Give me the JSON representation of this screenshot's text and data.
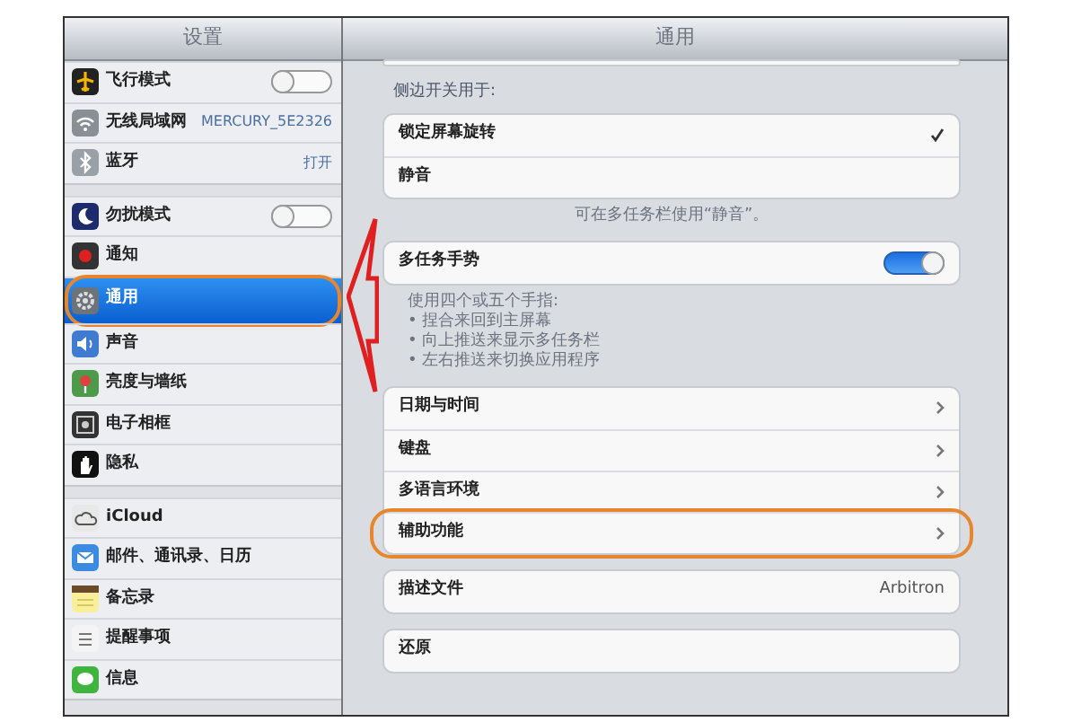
{
  "sidebar": {
    "title": "设置",
    "groups": [
      {
        "items": [
          {
            "label": "飞行模式",
            "kind": "toggle",
            "on": false,
            "selected": false,
            "circled": false
          },
          {
            "label": "无线局域网",
            "kind": "value",
            "value": "MERCURY_5E2326",
            "selected": false,
            "circled": false
          },
          {
            "label": "蓝牙",
            "kind": "value",
            "value": "打开",
            "selected": false,
            "circled": false
          }
        ]
      },
      {
        "items": [
          {
            "label": "勿扰模式",
            "kind": "toggle",
            "on": false,
            "selected": false,
            "circled": false
          },
          {
            "label": "通知",
            "kind": "plain",
            "selected": false,
            "circled": false
          },
          {
            "label": "通用",
            "kind": "plain",
            "selected": true,
            "circled": true
          },
          {
            "label": "声音",
            "kind": "plain",
            "selected": false,
            "circled": false
          },
          {
            "label": "亮度与墙纸",
            "kind": "plain",
            "selected": false,
            "circled": false
          },
          {
            "label": "电子相框",
            "kind": "plain",
            "selected": false,
            "circled": false
          },
          {
            "label": "隐私",
            "kind": "plain",
            "selected": false,
            "circled": false
          }
        ]
      },
      {
        "items": [
          {
            "label": "iCloud",
            "kind": "plain",
            "selected": false,
            "circled": false
          },
          {
            "label": "邮件、通讯录、日历",
            "kind": "plain",
            "selected": false,
            "circled": false
          },
          {
            "label": "备忘录",
            "kind": "plain",
            "selected": false,
            "circled": false
          },
          {
            "label": "提醒事项",
            "kind": "plain",
            "selected": false,
            "circled": false
          },
          {
            "label": "信息",
            "kind": "plain",
            "selected": false,
            "circled": false
          }
        ]
      }
    ]
  },
  "detail": {
    "title": "通用",
    "groups": [
      {
        "header": "侧边开关用于:",
        "footer": [
          "可在多任务栏使用“静音”。"
        ],
        "rows": [
          {
            "label": "锁定屏幕旋转",
            "kind": "check",
            "checked": true,
            "circled": false
          },
          {
            "label": "静音",
            "kind": "check",
            "checked": false,
            "circled": false
          }
        ]
      },
      {
        "footer": [
          "使用四个或五个手指:",
          "• 捏合来回到主屏幕",
          "• 向上推送来显示多任务栏",
          "• 左右推送来切换应用程序"
        ],
        "rows": [
          {
            "label": "多任务手势",
            "kind": "toggle",
            "on": true,
            "circled": false
          }
        ]
      },
      {
        "rows": [
          {
            "label": "日期与时间",
            "kind": "disclosure",
            "circled": false
          },
          {
            "label": "键盘",
            "kind": "disclosure",
            "circled": false
          },
          {
            "label": "多语言环境",
            "kind": "disclosure",
            "circled": false
          },
          {
            "label": "辅助功能",
            "kind": "disclosure",
            "circled": true
          }
        ]
      },
      {
        "rows": [
          {
            "label": "描述文件",
            "kind": "value",
            "value": "Arbitron",
            "circled": false
          }
        ]
      },
      {
        "rows": [
          {
            "label": "还原",
            "kind": "plain",
            "circled": false
          }
        ]
      }
    ]
  }
}
